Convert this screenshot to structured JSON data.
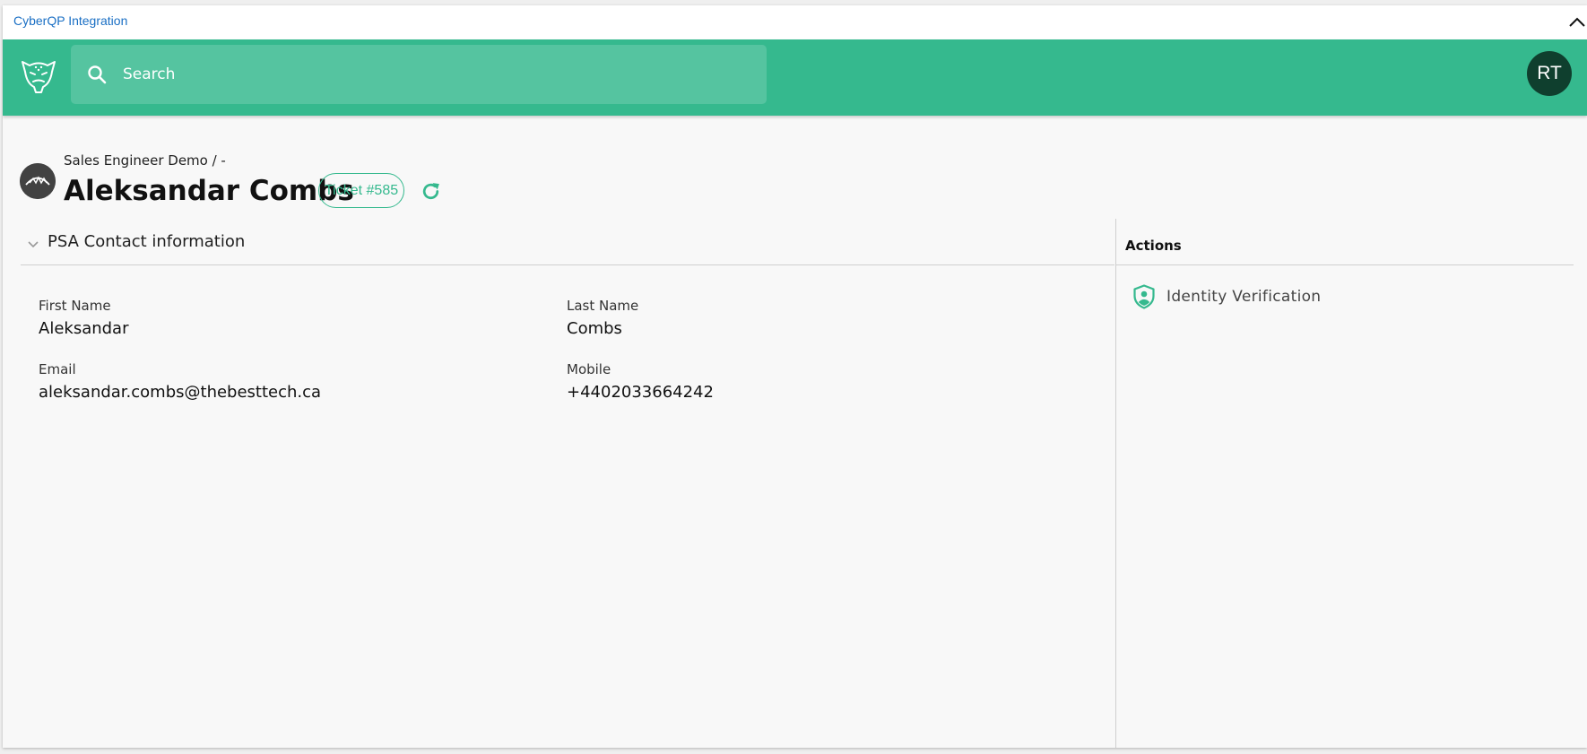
{
  "integration": {
    "title": "CyberQP Integration"
  },
  "header": {
    "search_placeholder": "Search",
    "user_initials": "RT",
    "brand_color": "#35b98e"
  },
  "contact": {
    "breadcrumb": "Sales Engineer Demo / -",
    "name": "Aleksandar Combs",
    "ticket_label": "Ticket #585"
  },
  "psa_section": {
    "title": "PSA Contact information",
    "fields": [
      {
        "label": "First Name",
        "value": "Aleksandar"
      },
      {
        "label": "Last Name",
        "value": "Combs"
      },
      {
        "label": "Email",
        "value": "aleksandar.combs@thebesttech.ca"
      },
      {
        "label": "Mobile",
        "value": "+4402033664242"
      }
    ]
  },
  "actions": {
    "title": "Actions",
    "items": [
      {
        "label": "Identity Verification",
        "icon": "shield-person-icon"
      }
    ]
  }
}
